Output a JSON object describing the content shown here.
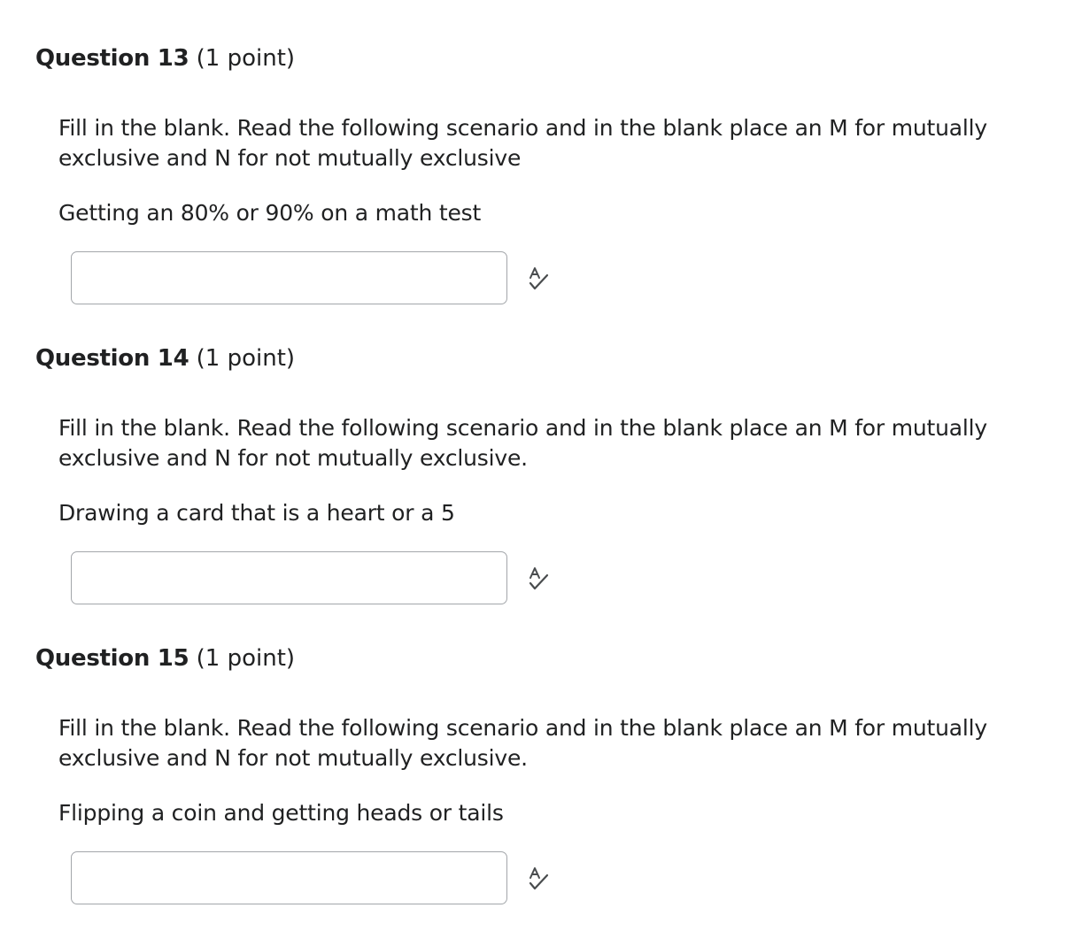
{
  "questions": [
    {
      "number_label": "Question 13",
      "points_label": "(1 point)",
      "prompt": "Fill in the blank. Read the following scenario and in the blank place an M for mutually exclusive and N for not mutually exclusive",
      "scenario": "Getting an 80% or 90% on a math test",
      "answer_value": "",
      "spellcheck_icon": "spellcheck-icon"
    },
    {
      "number_label": "Question 14",
      "points_label": "(1 point)",
      "prompt": "Fill in the blank. Read the following scenario and in the blank place an M for mutually exclusive and N for not mutually exclusive.",
      "scenario": "Drawing a card that is a heart or a 5",
      "answer_value": "",
      "spellcheck_icon": "spellcheck-icon"
    },
    {
      "number_label": "Question 15",
      "points_label": "(1 point)",
      "prompt": "Fill in the blank. Read the following scenario and in the blank place an M for mutually exclusive and N for not mutually exclusive.",
      "scenario": "Flipping a coin and getting heads or tails",
      "answer_value": "",
      "spellcheck_icon": "spellcheck-icon"
    }
  ],
  "colors": {
    "text": "#202122",
    "input_border": "#a3a6aa",
    "icon": "#494c4e"
  }
}
